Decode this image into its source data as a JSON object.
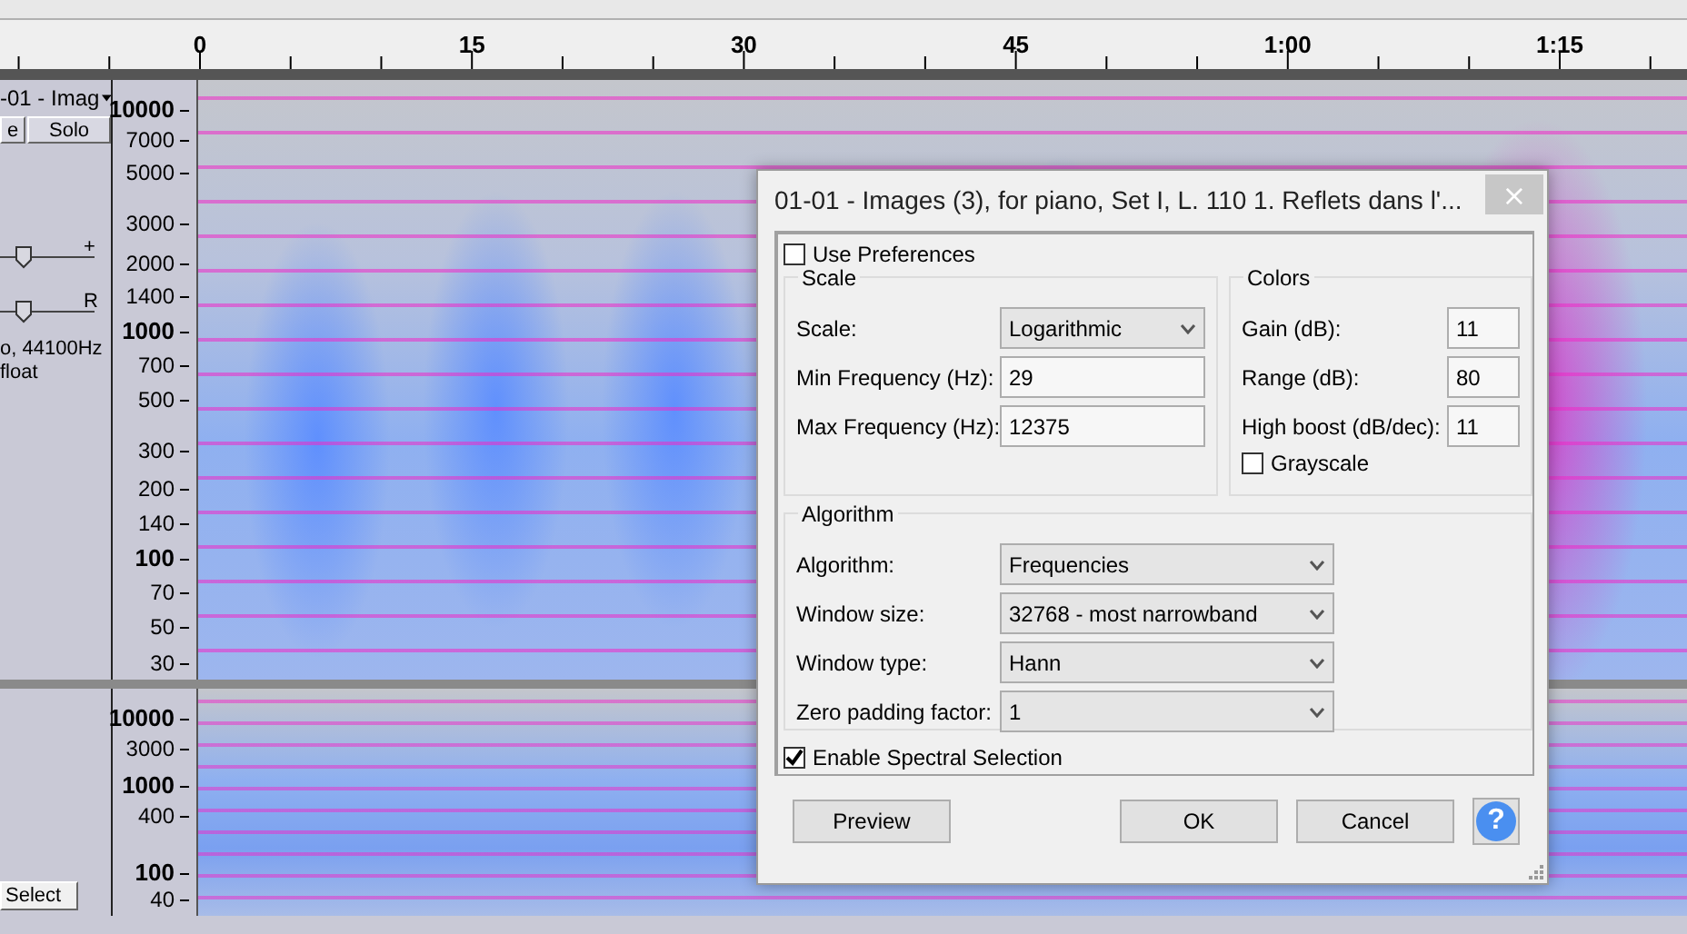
{
  "ruler": {
    "ticks": [
      "0",
      "15",
      "30",
      "45",
      "1:00",
      "1:15"
    ]
  },
  "tracks": [
    {
      "name": "-01 - Imag",
      "mute_label": "e",
      "solo_label": "Solo",
      "gain": {
        "label": "+",
        "level": 0.25
      },
      "pan": {
        "label": "R",
        "level": 0.25
      },
      "info": [
        "o, 44100Hz",
        "float"
      ],
      "scale": [
        {
          "label": "10000",
          "major": true
        },
        {
          "label": "7000",
          "major": false
        },
        {
          "label": "5000",
          "major": false
        },
        {
          "label": "3000",
          "major": false
        },
        {
          "label": "2000",
          "major": false
        },
        {
          "label": "1400",
          "major": false
        },
        {
          "label": "1000",
          "major": true
        },
        {
          "label": "700",
          "major": false
        },
        {
          "label": "500",
          "major": false
        },
        {
          "label": "300",
          "major": false
        },
        {
          "label": "200",
          "major": false
        },
        {
          "label": "140",
          "major": false
        },
        {
          "label": "100",
          "major": true
        },
        {
          "label": "70",
          "major": false
        },
        {
          "label": "50",
          "major": false
        },
        {
          "label": "30",
          "major": false
        }
      ]
    },
    {
      "select_label": "Select",
      "scale": [
        {
          "label": "10000",
          "major": true
        },
        {
          "label": "3000",
          "major": false
        },
        {
          "label": "1000",
          "major": true
        },
        {
          "label": "400",
          "major": false
        },
        {
          "label": "100",
          "major": true
        },
        {
          "label": "40",
          "major": false
        }
      ]
    }
  ],
  "dialog": {
    "title": "01-01 - Images (3), for piano, Set I, L. 110 1. Reflets dans l'...",
    "close": "×",
    "use_preferences": {
      "label": "Use Preferences",
      "checked": false
    },
    "scale": {
      "title": "Scale",
      "rows": [
        {
          "label": "Scale:",
          "kind": "dropdown",
          "value": "Logarithmic"
        },
        {
          "label": "Min Frequency (Hz):",
          "kind": "text",
          "value": "29"
        },
        {
          "label": "Max Frequency (Hz):",
          "kind": "text",
          "value": "12375"
        }
      ]
    },
    "colors": {
      "title": "Colors",
      "rows": [
        {
          "label": "Gain (dB):",
          "value": "11"
        },
        {
          "label": "Range (dB):",
          "value": "80"
        },
        {
          "label": "High boost (dB/dec):",
          "value": "11"
        }
      ],
      "grayscale": {
        "label": "Grayscale",
        "checked": false
      }
    },
    "algorithm": {
      "title": "Algorithm",
      "rows": [
        {
          "label": "Algorithm:",
          "kind": "dropdown",
          "value": "Frequencies"
        },
        {
          "label": "Window size:",
          "kind": "dropdown",
          "value": "32768 - most narrowband"
        },
        {
          "label": "Window type:",
          "kind": "dropdown",
          "value": "Hann"
        },
        {
          "label": "Zero padding factor:",
          "kind": "dropdown",
          "value": "1"
        }
      ]
    },
    "spectral_selection": {
      "label": "Enable Spectral Selection",
      "checked": true
    },
    "buttons": [
      {
        "label": "Preview",
        "kind": "left"
      },
      {
        "label": "OK",
        "kind": "right"
      },
      {
        "label": "Cancel",
        "kind": "right"
      }
    ],
    "help": "?"
  }
}
